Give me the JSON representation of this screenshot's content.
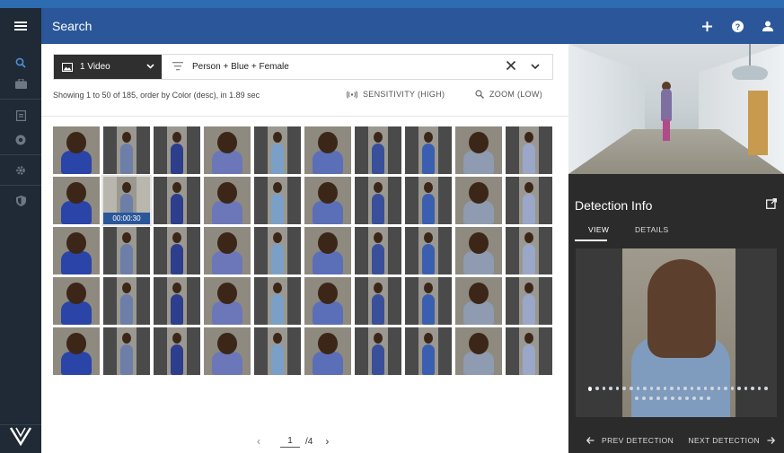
{
  "header": {
    "title": "Search",
    "icons": [
      "menu-icon",
      "plus-icon",
      "help-icon",
      "user-icon"
    ]
  },
  "sidebar": {
    "icons": [
      "search-icon",
      "briefcase-icon",
      "document-icon",
      "record-icon",
      "settings-icon",
      "shield-icon",
      "logo"
    ]
  },
  "filterbar": {
    "video_label": "1 Video",
    "filter_text": "Person + Blue + Female"
  },
  "status": {
    "summary": "Showing 1 to 50 of 185, order by Color (desc), in 1.89 sec",
    "sensitivity": "SENSITIVITY (HIGH)",
    "zoom": "ZOOM (LOW)"
  },
  "results": {
    "selected_badge": "00:00:30",
    "rows": 5,
    "cols": 10
  },
  "pager": {
    "current": "1",
    "of": "/4"
  },
  "detection": {
    "title": "Detection Info",
    "tab_view": "VIEW",
    "tab_details": "DETAILS",
    "prev_label": "PREV DETECTION",
    "next_label": "NEXT DETECTION"
  },
  "colors": {
    "header_blue": "#2b579a",
    "sidebar_dark": "#1f2a36",
    "panel_dark": "#2b2b2b"
  }
}
